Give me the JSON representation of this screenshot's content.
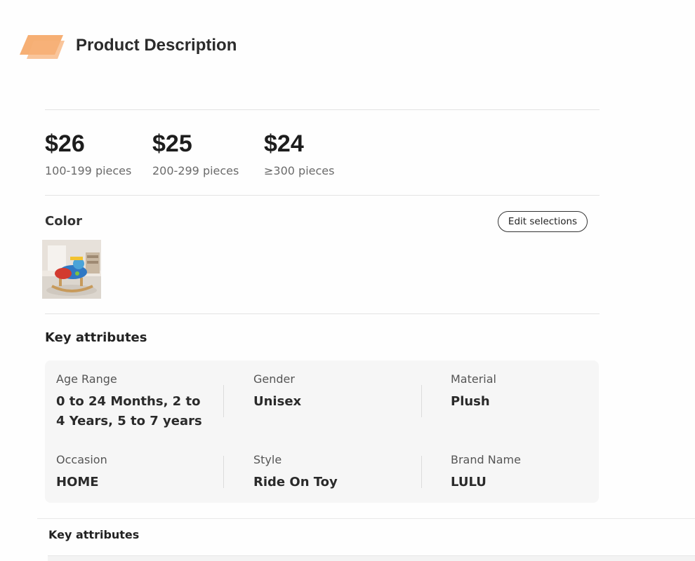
{
  "header": {
    "title": "Product Description",
    "logo_colors": [
      "#f5a15c",
      "#f7b27a"
    ]
  },
  "pricing": [
    {
      "price": "$26",
      "quantity": "100-199 pieces"
    },
    {
      "price": "$25",
      "quantity": "200-299 pieces"
    },
    {
      "price": "$24",
      "quantity": "≥300 pieces"
    }
  ],
  "color_section": {
    "label": "Color",
    "edit_button_label": "Edit selections",
    "swatch_icon": "rocking-plane-toy-image"
  },
  "key_attributes": {
    "title": "Key attributes",
    "items": [
      {
        "label": "Age Range",
        "value": "0 to 24 Months, 2 to 4 Years, 5 to 7 years"
      },
      {
        "label": "Gender",
        "value": "Unisex"
      },
      {
        "label": "Material",
        "value": "Plush"
      },
      {
        "label": "Occasion",
        "value": "HOME"
      },
      {
        "label": "Style",
        "value": "Ride On Toy"
      },
      {
        "label": "Brand Name",
        "value": "LULU"
      }
    ]
  },
  "secondary_section": {
    "title": "Key attributes"
  }
}
